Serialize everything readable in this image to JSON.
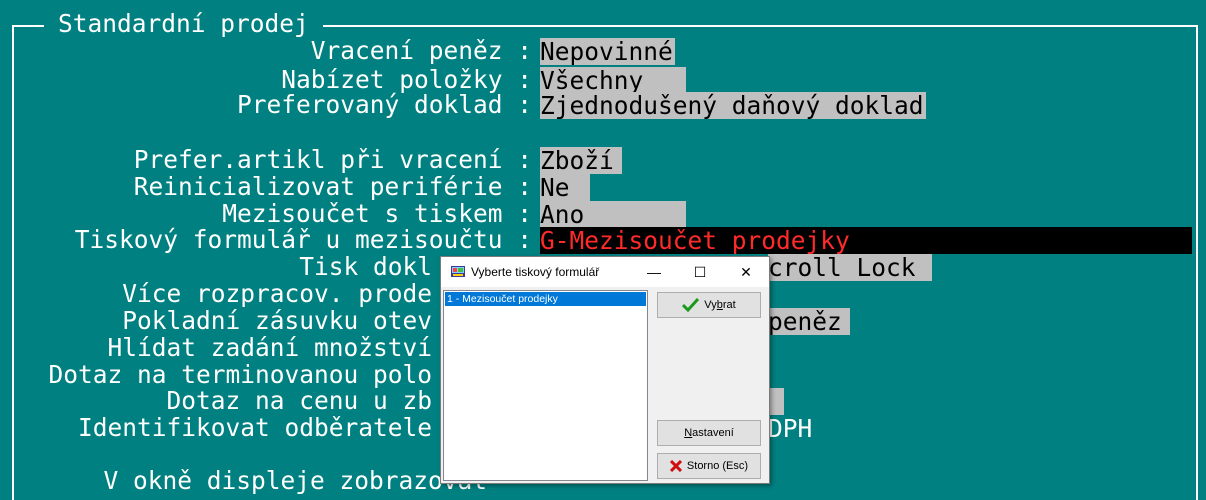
{
  "section_title": "Standardní prodej",
  "rows": [
    {
      "label": "Vracení peněz :",
      "value": "Nepovinné"
    },
    {
      "label": "Nabízet položky :",
      "value": "Všechny"
    },
    {
      "label": "Preferovaný doklad :",
      "value": "Zjednodušený daňový doklad"
    },
    {
      "label": "Prefer.artikl při vracení :",
      "value": "Zboží"
    },
    {
      "label": "Reinicializovat periférie :",
      "value": "Ne"
    },
    {
      "label": "Mezisoučet s tiskem :",
      "value": "Ano"
    },
    {
      "label": "Tiskový formulář u mezisoučtu :",
      "value": "G-Mezisoučet prodejky"
    },
    {
      "label": "Tisk dokl",
      "value": "croll Lock"
    },
    {
      "label": "Více rozpracov. prode",
      "value": ""
    },
    {
      "label": "Pokladní zásuvku otev",
      "value": "peněz"
    },
    {
      "label": "Hlídat zadání množství",
      "value": ""
    },
    {
      "label": "Dotaz na terminovanou polo",
      "value": ""
    },
    {
      "label": "Dotaz na cenu u zb",
      "value": ""
    },
    {
      "label": "Identifikovat odběratele",
      "value": "DPH"
    },
    {
      "label": "V okně displeje zobrazovat",
      "value": ""
    }
  ],
  "dialog": {
    "title": "Vyberte tiskový formulář",
    "list_items": [
      "1 - Mezisoučet prodejky"
    ],
    "buttons": {
      "select": {
        "before": "Vy",
        "underline": "b",
        "after": "rat"
      },
      "settings": {
        "before": "",
        "underline": "N",
        "after": "astavení"
      },
      "cancel": "Storno (Esc)"
    },
    "window_controls": {
      "minimize": "—",
      "maximize": "☐",
      "close": "✕"
    }
  },
  "colors": {
    "background": "#008080",
    "field": "#c0c0c0",
    "active_field_bg": "#000000",
    "active_field_text": "#ff2a2a",
    "selection": "#0078d7"
  }
}
